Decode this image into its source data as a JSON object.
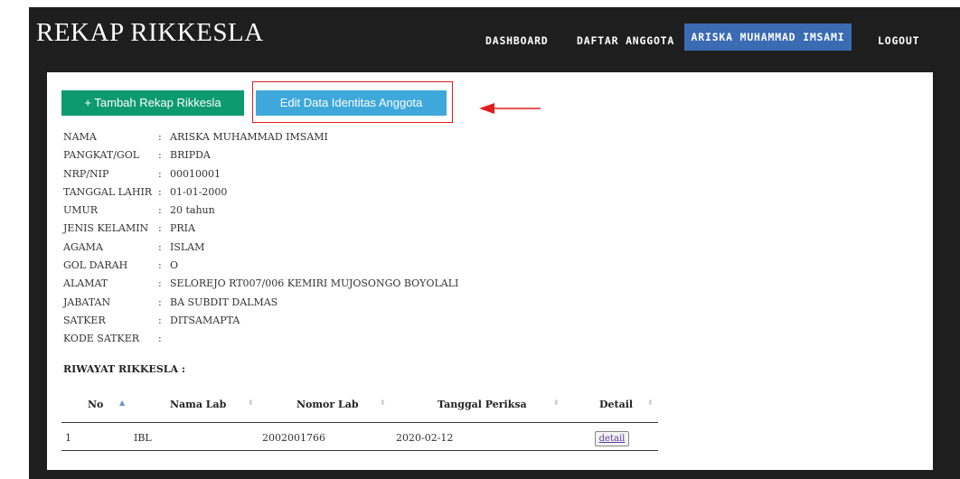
{
  "app": {
    "title": "REKAP RIKKESLA"
  },
  "nav": {
    "items": [
      {
        "label": "DASHBOARD"
      },
      {
        "label": "DAFTAR ANGGOTA"
      },
      {
        "label": "ARISKA MUHAMMAD IMSAMI"
      },
      {
        "label": "LOGOUT"
      }
    ],
    "active_index": 2
  },
  "actions": {
    "add_label": "+ Tambah Rekap Rikkesla",
    "edit_label": "Edit Data Identitas Anggota"
  },
  "profile": {
    "separator": ":",
    "fields": [
      {
        "label": "NAMA",
        "value": "ARISKA MUHAMMAD IMSAMI"
      },
      {
        "label": "PANGKAT/GOL",
        "value": "BRIPDA"
      },
      {
        "label": "NRP/NIP",
        "value": "00010001"
      },
      {
        "label": "TANGGAL LAHIR",
        "value": "01-01-2000"
      },
      {
        "label": "UMUR",
        "value": "20 tahun"
      },
      {
        "label": "JENIS KELAMIN",
        "value": "PRIA"
      },
      {
        "label": "AGAMA",
        "value": "ISLAM"
      },
      {
        "label": "GOL DARAH",
        "value": "O"
      },
      {
        "label": "ALAMAT",
        "value": "SELOREJO RT007/006 KEMIRI MUJOSONGO BOYOLALI"
      },
      {
        "label": "JABATAN",
        "value": "BA SUBDIT DALMAS"
      },
      {
        "label": "SATKER",
        "value": "DITSAMAPTA"
      },
      {
        "label": "KODE SATKER",
        "value": ""
      }
    ]
  },
  "history": {
    "title": "RIWAYAT RIKKESLA :",
    "columns": [
      "No",
      "Nama Lab",
      "Nomor Lab",
      "Tanggal Periksa",
      "Detail"
    ],
    "rows": [
      {
        "no": "1",
        "nama_lab": "IBL",
        "nomor_lab": "2002001766",
        "tanggal": "2020-02-12",
        "detail": "detail"
      }
    ]
  },
  "colors": {
    "nav_bg": "#1e1e1e",
    "nav_active": "#3a6bb3",
    "add_button": "#0e9a6f",
    "edit_button": "#3ea8da",
    "annotation": "#e01e1e"
  }
}
